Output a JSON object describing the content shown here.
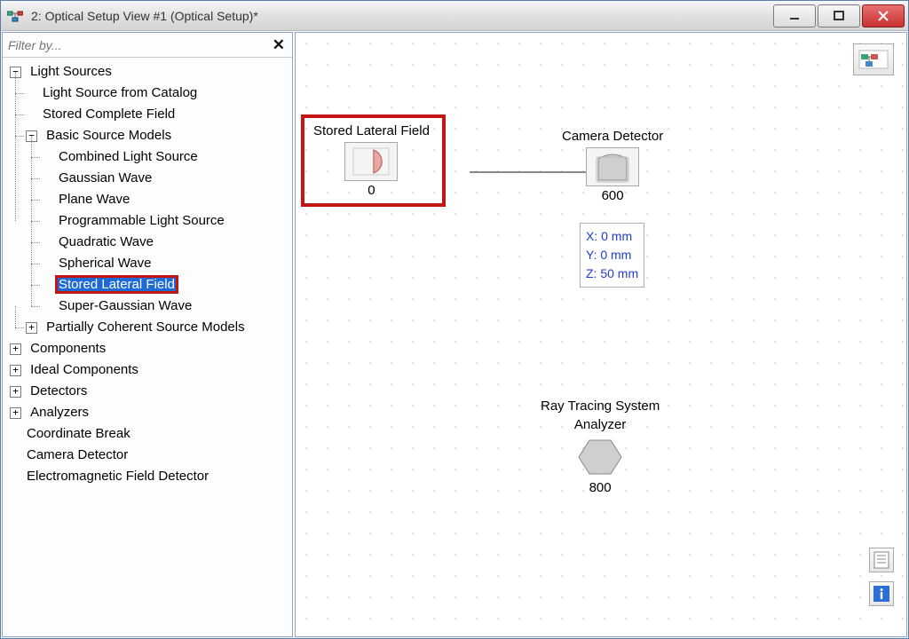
{
  "window": {
    "title": "2: Optical Setup View #1 (Optical Setup)*"
  },
  "filter": {
    "placeholder": "Filter by...",
    "clear_glyph": "✕"
  },
  "tree": {
    "light_sources": "Light Sources",
    "light_source_from_catalog": "Light Source from Catalog",
    "stored_complete_field": "Stored Complete Field",
    "basic_source_models": "Basic Source Models",
    "combined_light_source": "Combined Light Source",
    "gaussian_wave": "Gaussian Wave",
    "plane_wave": "Plane Wave",
    "programmable_light_source": "Programmable Light Source",
    "quadratic_wave": "Quadratic Wave",
    "spherical_wave": "Spherical Wave",
    "stored_lateral_field": "Stored Lateral Field",
    "super_gaussian_wave": "Super-Gaussian Wave",
    "partially_coherent": "Partially Coherent Source Models",
    "components": "Components",
    "ideal_components": "Ideal Components",
    "detectors": "Detectors",
    "analyzers": "Analyzers",
    "coordinate_break": "Coordinate Break",
    "camera_detector": "Camera Detector",
    "em_field_detector": "Electromagnetic Field Detector"
  },
  "canvas": {
    "node1": {
      "label": "Stored Lateral Field",
      "id": "0"
    },
    "node2": {
      "label": "Camera Detector",
      "id": "600"
    },
    "node3": {
      "label": "Ray Tracing System",
      "label2": "Analyzer",
      "id": "800"
    },
    "coords": {
      "x": "X: 0 mm",
      "y": "Y: 0 mm",
      "z": "Z: 50 mm"
    }
  },
  "expand": {
    "plus": "+",
    "minus": "−"
  }
}
